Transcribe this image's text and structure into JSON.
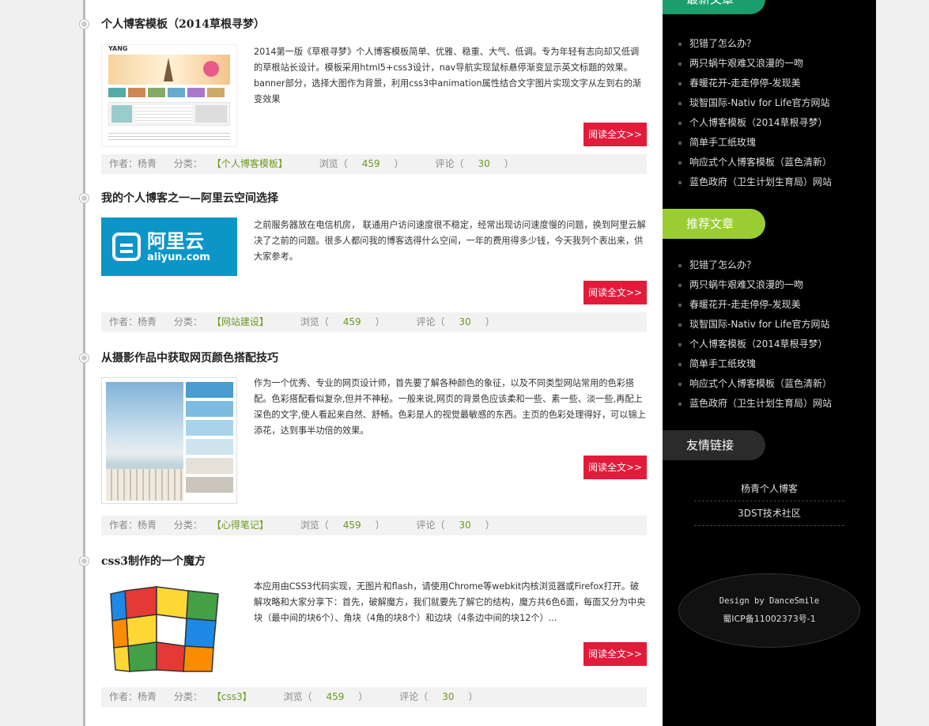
{
  "articles": [
    {
      "title": "个人博客模板（2014草根寻梦）",
      "summary": "2014第一版《草根寻梦》个人博客模板简单、优雅、稳重、大气、低调。专为年轻有志向却又低调的草根站长设计。模板采用html5+css3设计，nav导航实现鼠标悬停渐变显示英文标题的效果。banner部分，选择大图作为背景，利用css3中animation属性结合文字图片实现文字从左到右的渐变效果",
      "read_more": "阅读全文>>",
      "author": "作者：杨青",
      "category_label": "分类：",
      "category": "【个人博客模板】",
      "views_label": "浏览（",
      "views": "459",
      "views_close": "）",
      "comments_label": "评论（",
      "comments": "30",
      "comments_close": "）",
      "thumb_text": "YANG"
    },
    {
      "title": "我的个人博客之一—阿里云空间选择",
      "summary": "之前服务器放在电信机房， 联通用户访问速度很不稳定，经常出现访问速度慢的问题，换到阿里云解决了之前的问题。很多人都问我的博客选得什么空间，一年的费用得多少钱，今天我列个表出来，供大家参考。",
      "read_more": "阅读全文>>",
      "author": "作者：杨青",
      "category_label": "分类：",
      "category": "【网站建设】",
      "views_label": "浏览（",
      "views": "459",
      "views_close": "）",
      "comments_label": "评论（",
      "comments": "30",
      "comments_close": "）",
      "thumb_text": "阿里云",
      "thumb_sub": "aliyun.com"
    },
    {
      "title": "从摄影作品中获取网页颜色搭配技巧",
      "summary": "作为一个优秀、专业的网页设计师，首先要了解各种颜色的象征，以及不同类型网站常用的色彩搭配。色彩搭配看似复杂,但并不神秘。一般来说,网页的背景色应该柔和一些、素一些、淡一些,再配上深色的文字,使人看起来自然、舒畅。色彩是人的视觉最敏感的东西。主页的色彩处理得好，可以锦上添花，达到事半功倍的效果。",
      "read_more": "阅读全文>>",
      "author": "作者：杨青",
      "category_label": "分类：",
      "category": "【心得笔记】",
      "views_label": "浏览（",
      "views": "459",
      "views_close": "）",
      "comments_label": "评论（",
      "comments": "30",
      "comments_close": "）"
    },
    {
      "title": "css3制作的一个魔方",
      "summary": "本应用由CSS3代码实现，无图片和flash，请使用Chrome等webkit内核浏览器或Firefox打开。破解攻略和大家分享下：首先，破解魔方，我们就要先了解它的结构，魔方共6色6面，每面又分为中央块（最中间的块6个）、角块（4角的块8个）和边块（4条边中间的块12个）...",
      "read_more": "阅读全文>>",
      "author": "作者：杨青",
      "category_label": "分类：",
      "category": "【css3】",
      "views_label": "浏览（",
      "views": "459",
      "views_close": "）",
      "comments_label": "评论（",
      "comments": "30",
      "comments_close": "）"
    }
  ],
  "sidebar": {
    "latest_title": "最新文章",
    "latest": [
      "犯错了怎么办？",
      "两只蜗牛艰难又浪漫的一吻",
      "春暖花开-走走停停-发现美",
      "琰智国际-Nativ for Life官方网站",
      "个人博客模板（2014草根寻梦）",
      "简单手工纸玫瑰",
      "响应式个人博客模板（蓝色清新）",
      "蓝色政府（卫生计划生育局）网站"
    ],
    "recommend_title": "推荐文章",
    "recommend": [
      "犯错了怎么办？",
      "两只蜗牛艰难又浪漫的一吻",
      "春暖花开-走走停停-发现美",
      "琰智国际-Nativ for Life官方网站",
      "个人博客模板（2014草根寻梦）",
      "简单手工纸玫瑰",
      "响应式个人博客模板（蓝色清新）",
      "蓝色政府（卫生计划生育局）网站"
    ],
    "links_title": "友情链接",
    "links": [
      "杨青个人博客",
      "3DST技术社区"
    ],
    "footer_design": "Design by DanceSmile",
    "footer_icp": "蜀ICP备11002373号-1"
  },
  "colors": {
    "accent_red": "#e31b3b",
    "accent_green": "#8bc34a",
    "sidebar_bg": "#000000"
  }
}
